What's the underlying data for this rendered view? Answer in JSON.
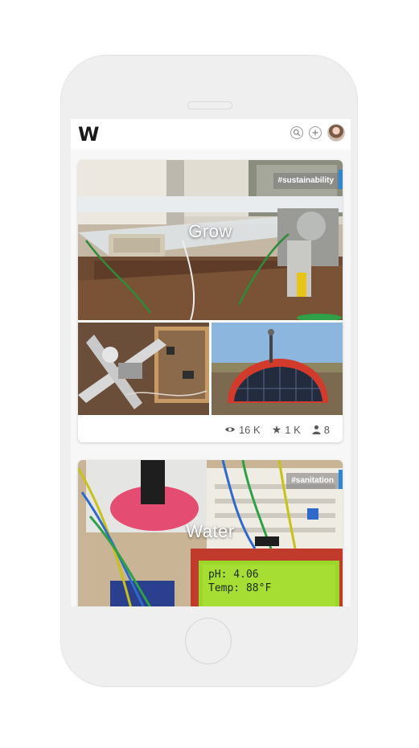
{
  "app": {
    "logo": "W",
    "buttons": [
      {
        "name": "search",
        "icon": "search-icon"
      },
      {
        "name": "add",
        "icon": "plus-icon"
      }
    ]
  },
  "cards": [
    {
      "title": "Grow",
      "tag": "#sustainability",
      "stats": {
        "views": "16 K",
        "stars": "1 K",
        "members": "8"
      }
    },
    {
      "title": "Water",
      "tag": "#sanitation",
      "lcd": {
        "line1": "pH: 4.06",
        "line2": "Temp: 88°F"
      }
    }
  ],
  "colors": {
    "accent": "#2e86d6",
    "tag_bg": "#8a8a8a",
    "lcd": "#9bd62a"
  }
}
